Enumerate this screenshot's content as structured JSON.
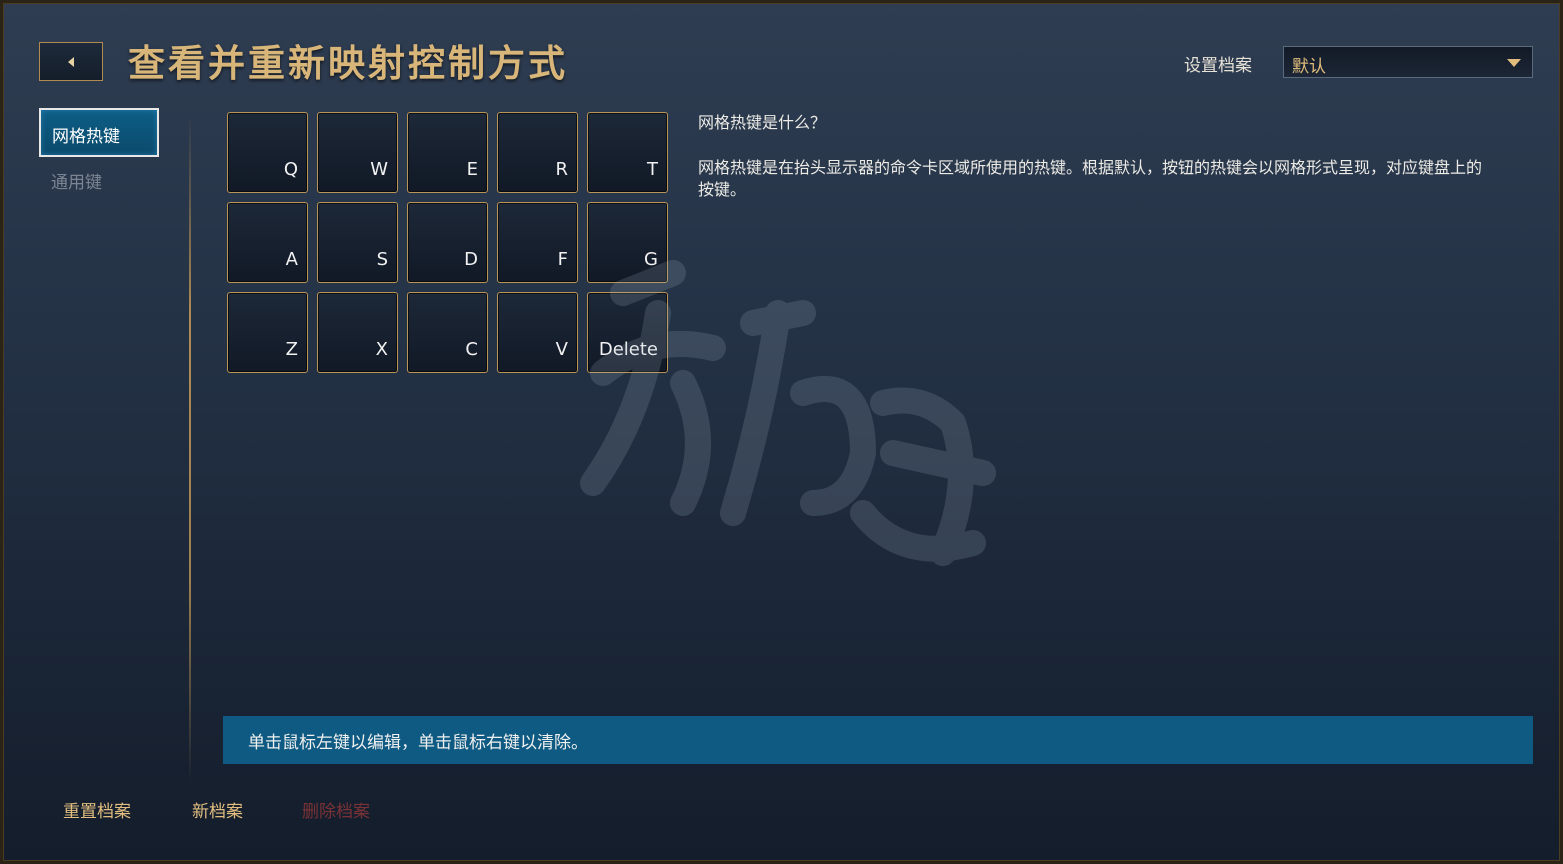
{
  "header": {
    "title": "查看并重新映射控制方式",
    "back_icon": "back-arrow-icon"
  },
  "profile": {
    "label": "设置档案",
    "selected": "默认",
    "dropdown_icon": "chevron-down-icon"
  },
  "sidebar": {
    "items": [
      {
        "label": "网格热键",
        "active": true
      },
      {
        "label": "通用键",
        "active": false
      }
    ]
  },
  "grid": {
    "rows": [
      [
        "Q",
        "W",
        "E",
        "R",
        "T"
      ],
      [
        "A",
        "S",
        "D",
        "F",
        "G"
      ],
      [
        "Z",
        "X",
        "C",
        "V",
        "Delete"
      ]
    ]
  },
  "help": {
    "title": "网格热键是什么？",
    "body": "网格热键是在抬头显示器的命令卡区域所使用的热键。根据默认，按钮的热键会以网格形式呈现，对应键盘上的按键。"
  },
  "hint": {
    "text": "单击鼠标左键以编辑，单击鼠标右键以清除。"
  },
  "footer": {
    "reset": "重置档案",
    "new": "新档案",
    "delete": "删除档案"
  },
  "colors": {
    "title_gold": "#d8b67a",
    "key_border": "#b89456",
    "active_tab": "#0d5e86",
    "hint_bar": "#0e5a82",
    "delete_disabled": "#7a3236"
  }
}
